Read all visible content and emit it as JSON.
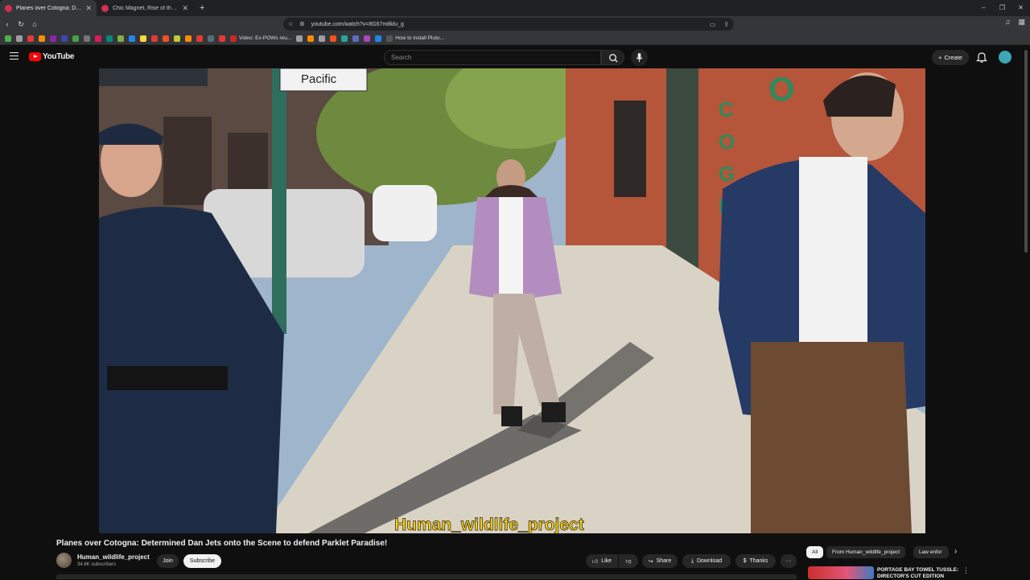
{
  "browser": {
    "tabs": [
      {
        "title": "Planes over Cotogna: Determ",
        "active": true
      },
      {
        "title": "Chic Magnet, Rise of the warrior wor",
        "active": false
      }
    ],
    "url": "youtube.com/watch?v=8G67m8klu_g",
    "bookmarks": [
      {
        "label": "Video: Ex-POWs reu...",
        "color": "#c62828"
      },
      {
        "label": "How to install Pluto...",
        "color": "#555555"
      }
    ],
    "window_controls": [
      "–",
      "❐",
      "✕"
    ]
  },
  "youtube": {
    "logo_text": "YouTube",
    "search_placeholder": "Search",
    "create_label": "Create",
    "brand_color": "#ff0000"
  },
  "video": {
    "watermark": "Human_wildlife_project",
    "watermark_color": "#f2d21b",
    "street_sign": "Pacific",
    "building_letters": "COGNA"
  },
  "meta": {
    "title": "Planes over Cotogna: Determined Dan Jets onto the Scene to defend Parklet Paradise!",
    "channel": "Human_wildlife_project",
    "subscribers": "34.6K subscribers",
    "join_label": "Join",
    "subscribe_label": "Subscribe",
    "like_label": "Like",
    "share_label": "Share",
    "download_label": "Download",
    "thanks_label": "Thanks"
  },
  "recommendations": {
    "chips": [
      "All",
      "From Human_wildlife_project",
      "Law enfor"
    ],
    "first": {
      "title": "PORTAGE BAY TOWEL TUSSLE: DIRECTOR'S CUT EDITION"
    }
  }
}
